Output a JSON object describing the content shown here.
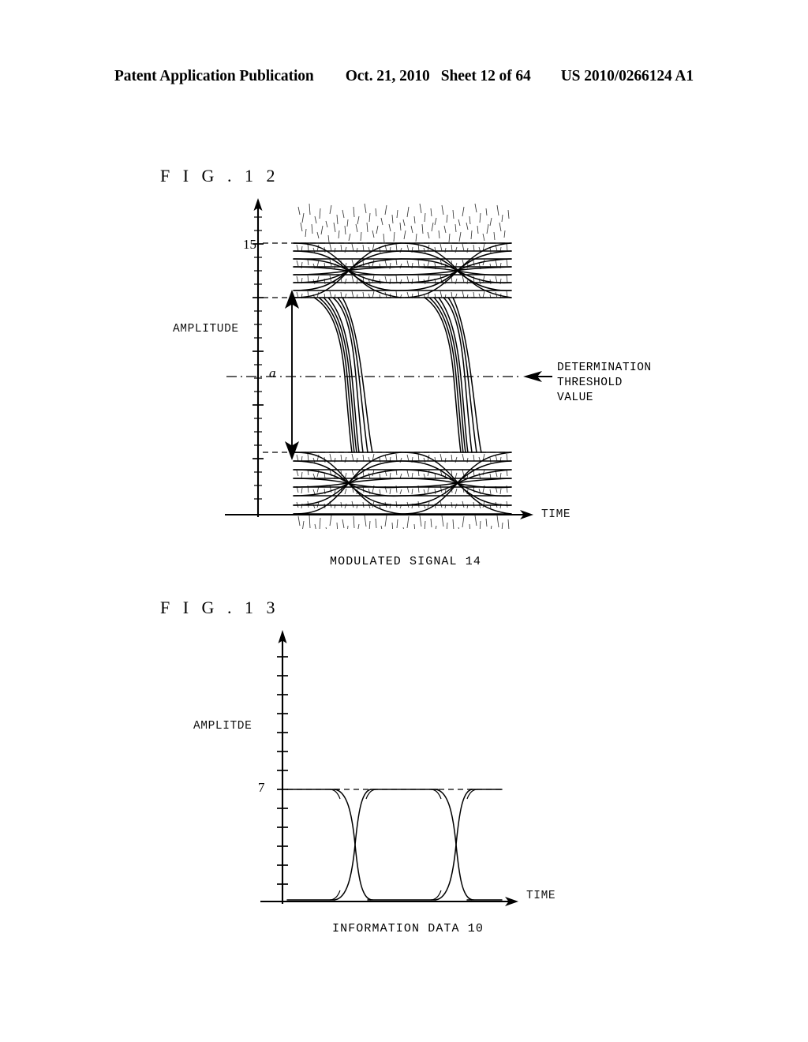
{
  "header": {
    "left": "Patent Application Publication",
    "date": "Oct. 21, 2010",
    "sheet": "Sheet 12 of 64",
    "patent_number": "US 2010/0266124 A1"
  },
  "figures": [
    {
      "id": "fig12",
      "label": "F I G .  1 2",
      "caption": "MODULATED SIGNAL 14",
      "y_axis_label": "AMPLITUDE",
      "x_axis_label": "TIME",
      "y_tick_label": "15",
      "dimension_label": "a",
      "annotation": {
        "line1": "DETERMINATION",
        "line2": "THRESHOLD",
        "line3": "VALUE"
      }
    },
    {
      "id": "fig13",
      "label": "F I G .  1 3",
      "caption": "INFORMATION DATA 10",
      "y_axis_label": "AMPLITDE",
      "x_axis_label": "TIME",
      "y_tick_label": "7"
    }
  ],
  "chart_data": [
    {
      "type": "line",
      "name": "fig12-eye-diagram",
      "title": "MODULATED SIGNAL 14",
      "xlabel": "TIME",
      "ylabel": "AMPLITUDE",
      "description": "16-level multilevel eye diagram with heavy noise; upper level cluster and lower level cluster separated by a wide open central region spanned by dimension 'a'. A determination threshold value line passes horizontally through the middle.",
      "levels": 16,
      "ylim": [
        0,
        15
      ],
      "y_ticks": [
        15
      ],
      "upper_cluster_levels": [
        15,
        14,
        13,
        12,
        11,
        10,
        9,
        8
      ],
      "lower_cluster_levels": [
        7,
        6,
        5,
        4,
        3,
        2,
        1,
        0
      ],
      "determination_threshold_value": 7.5,
      "dimension_a_span": [
        8,
        15
      ],
      "eye_crossings": 2,
      "grid": false,
      "legend": "none"
    },
    {
      "type": "line",
      "name": "fig13-eye-diagram",
      "title": "INFORMATION DATA 10",
      "xlabel": "TIME",
      "ylabel": "AMPLITDE",
      "description": "Two-level (binary) clean eye diagram with two crossing points; high level marked 7, low level at baseline 0.",
      "levels": 2,
      "ylim": [
        0,
        7
      ],
      "y_ticks": [
        7
      ],
      "high_level": 7,
      "low_level": 0,
      "eye_crossings": 2,
      "grid": false,
      "legend": "none"
    }
  ]
}
